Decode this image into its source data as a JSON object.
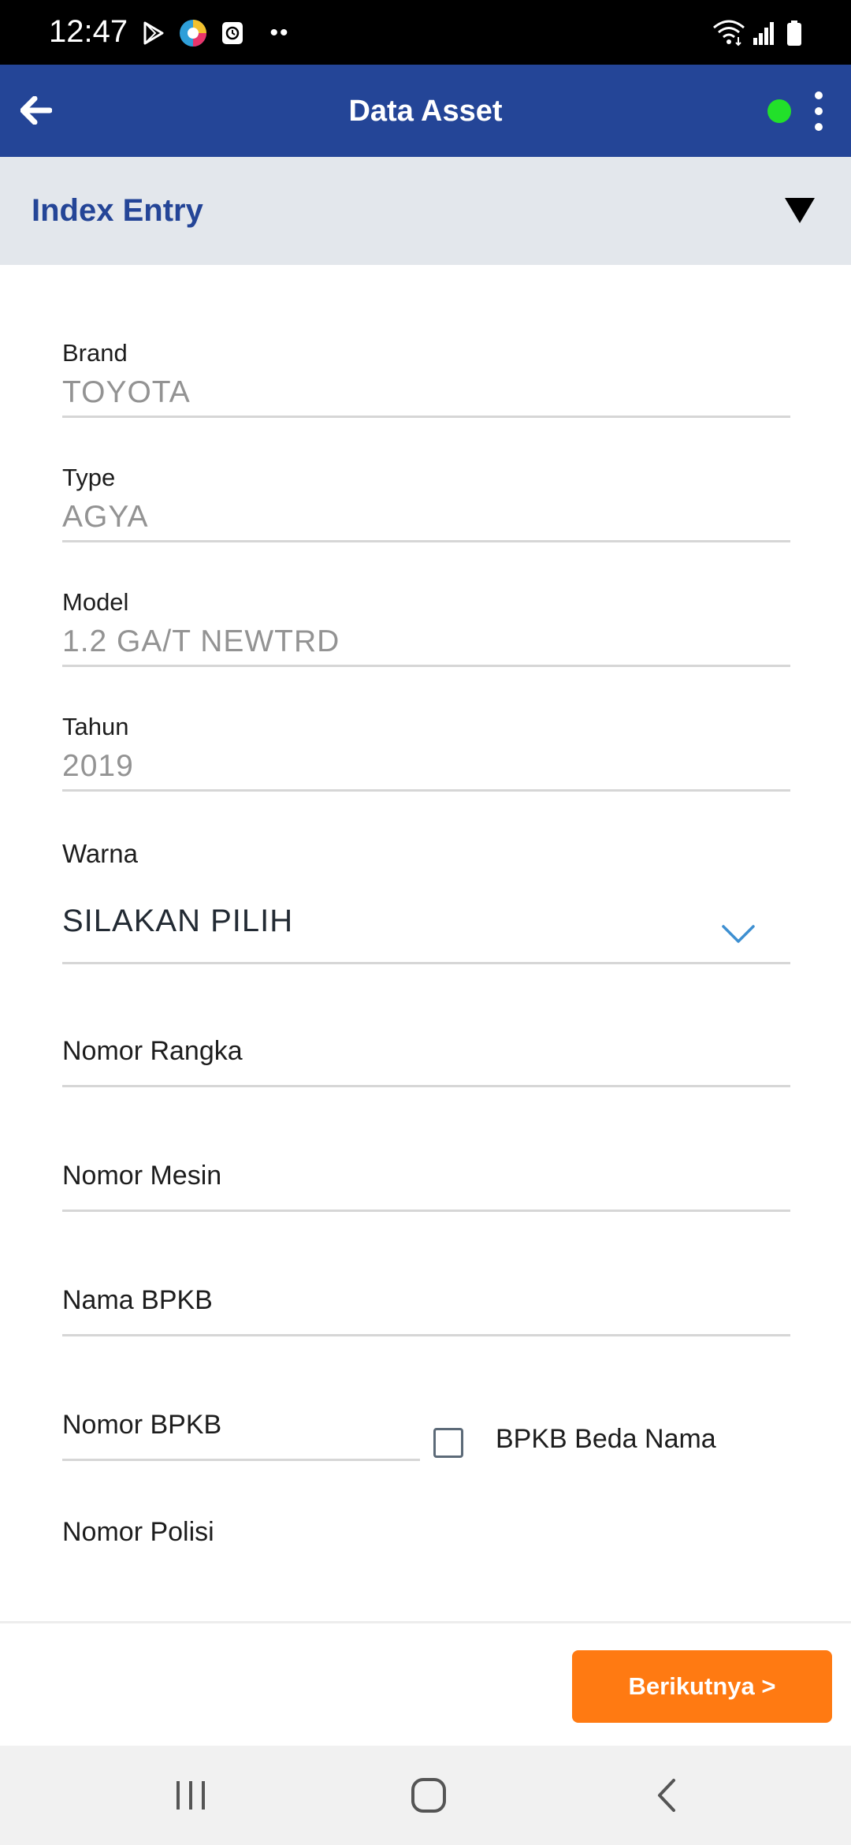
{
  "status_bar": {
    "time": "12:47",
    "icons": [
      "play-store-icon",
      "app-notification-icon",
      "clock-app-icon",
      "more-notifications-dots",
      "wifi-icon",
      "signal-icon",
      "battery-icon"
    ],
    "dots": "••"
  },
  "app_bar": {
    "title": "Data Asset",
    "status_color": "#22e02a",
    "background": "#244597"
  },
  "section": {
    "title": "Index Entry",
    "toggle_icon": "triangle-down-icon"
  },
  "form": {
    "brand": {
      "label": "Brand",
      "value": "TOYOTA"
    },
    "type": {
      "label": "Type",
      "value": "AGYA"
    },
    "model": {
      "label": "Model",
      "value": "1.2 GA/T NEWTRD"
    },
    "tahun": {
      "label": "Tahun",
      "value": "2019"
    },
    "warna": {
      "label": "Warna",
      "selected": "SILAKAN PILIH"
    },
    "nomor_rangka": {
      "placeholder": "Nomor Rangka"
    },
    "nomor_mesin": {
      "placeholder": "Nomor Mesin"
    },
    "nama_bpkb": {
      "placeholder": "Nama BPKB"
    },
    "nomor_bpkb": {
      "placeholder": "Nomor BPKB"
    },
    "bpkb_beda_nama": {
      "label": "BPKB Beda Nama",
      "checked": false
    },
    "nomor_polisi": {
      "placeholder": "Nomor Polisi"
    }
  },
  "actions": {
    "next_label": "Berikutnya >",
    "next_color": "#ff7a12"
  },
  "system_nav": {
    "icons": [
      "recents-icon",
      "home-icon",
      "back-nav-icon"
    ]
  }
}
